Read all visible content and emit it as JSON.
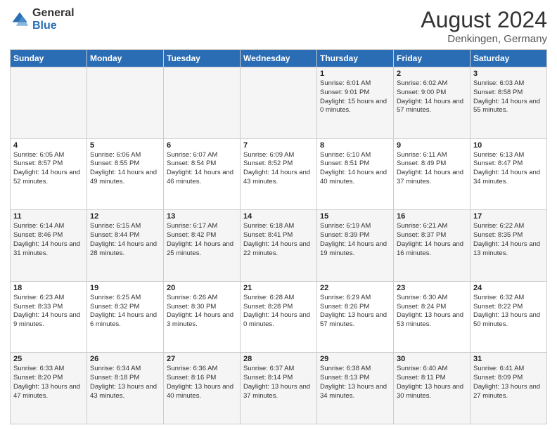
{
  "logo": {
    "general": "General",
    "blue": "Blue"
  },
  "header": {
    "month": "August 2024",
    "location": "Denkingen, Germany"
  },
  "weekdays": [
    "Sunday",
    "Monday",
    "Tuesday",
    "Wednesday",
    "Thursday",
    "Friday",
    "Saturday"
  ],
  "weeks": [
    [
      {
        "day": "",
        "info": ""
      },
      {
        "day": "",
        "info": ""
      },
      {
        "day": "",
        "info": ""
      },
      {
        "day": "",
        "info": ""
      },
      {
        "day": "1",
        "info": "Sunrise: 6:01 AM\nSunset: 9:01 PM\nDaylight: 15 hours and 0 minutes."
      },
      {
        "day": "2",
        "info": "Sunrise: 6:02 AM\nSunset: 9:00 PM\nDaylight: 14 hours and 57 minutes."
      },
      {
        "day": "3",
        "info": "Sunrise: 6:03 AM\nSunset: 8:58 PM\nDaylight: 14 hours and 55 minutes."
      }
    ],
    [
      {
        "day": "4",
        "info": "Sunrise: 6:05 AM\nSunset: 8:57 PM\nDaylight: 14 hours and 52 minutes."
      },
      {
        "day": "5",
        "info": "Sunrise: 6:06 AM\nSunset: 8:55 PM\nDaylight: 14 hours and 49 minutes."
      },
      {
        "day": "6",
        "info": "Sunrise: 6:07 AM\nSunset: 8:54 PM\nDaylight: 14 hours and 46 minutes."
      },
      {
        "day": "7",
        "info": "Sunrise: 6:09 AM\nSunset: 8:52 PM\nDaylight: 14 hours and 43 minutes."
      },
      {
        "day": "8",
        "info": "Sunrise: 6:10 AM\nSunset: 8:51 PM\nDaylight: 14 hours and 40 minutes."
      },
      {
        "day": "9",
        "info": "Sunrise: 6:11 AM\nSunset: 8:49 PM\nDaylight: 14 hours and 37 minutes."
      },
      {
        "day": "10",
        "info": "Sunrise: 6:13 AM\nSunset: 8:47 PM\nDaylight: 14 hours and 34 minutes."
      }
    ],
    [
      {
        "day": "11",
        "info": "Sunrise: 6:14 AM\nSunset: 8:46 PM\nDaylight: 14 hours and 31 minutes."
      },
      {
        "day": "12",
        "info": "Sunrise: 6:15 AM\nSunset: 8:44 PM\nDaylight: 14 hours and 28 minutes."
      },
      {
        "day": "13",
        "info": "Sunrise: 6:17 AM\nSunset: 8:42 PM\nDaylight: 14 hours and 25 minutes."
      },
      {
        "day": "14",
        "info": "Sunrise: 6:18 AM\nSunset: 8:41 PM\nDaylight: 14 hours and 22 minutes."
      },
      {
        "day": "15",
        "info": "Sunrise: 6:19 AM\nSunset: 8:39 PM\nDaylight: 14 hours and 19 minutes."
      },
      {
        "day": "16",
        "info": "Sunrise: 6:21 AM\nSunset: 8:37 PM\nDaylight: 14 hours and 16 minutes."
      },
      {
        "day": "17",
        "info": "Sunrise: 6:22 AM\nSunset: 8:35 PM\nDaylight: 14 hours and 13 minutes."
      }
    ],
    [
      {
        "day": "18",
        "info": "Sunrise: 6:23 AM\nSunset: 8:33 PM\nDaylight: 14 hours and 9 minutes."
      },
      {
        "day": "19",
        "info": "Sunrise: 6:25 AM\nSunset: 8:32 PM\nDaylight: 14 hours and 6 minutes."
      },
      {
        "day": "20",
        "info": "Sunrise: 6:26 AM\nSunset: 8:30 PM\nDaylight: 14 hours and 3 minutes."
      },
      {
        "day": "21",
        "info": "Sunrise: 6:28 AM\nSunset: 8:28 PM\nDaylight: 14 hours and 0 minutes."
      },
      {
        "day": "22",
        "info": "Sunrise: 6:29 AM\nSunset: 8:26 PM\nDaylight: 13 hours and 57 minutes."
      },
      {
        "day": "23",
        "info": "Sunrise: 6:30 AM\nSunset: 8:24 PM\nDaylight: 13 hours and 53 minutes."
      },
      {
        "day": "24",
        "info": "Sunrise: 6:32 AM\nSunset: 8:22 PM\nDaylight: 13 hours and 50 minutes."
      }
    ],
    [
      {
        "day": "25",
        "info": "Sunrise: 6:33 AM\nSunset: 8:20 PM\nDaylight: 13 hours and 47 minutes."
      },
      {
        "day": "26",
        "info": "Sunrise: 6:34 AM\nSunset: 8:18 PM\nDaylight: 13 hours and 43 minutes."
      },
      {
        "day": "27",
        "info": "Sunrise: 6:36 AM\nSunset: 8:16 PM\nDaylight: 13 hours and 40 minutes."
      },
      {
        "day": "28",
        "info": "Sunrise: 6:37 AM\nSunset: 8:14 PM\nDaylight: 13 hours and 37 minutes."
      },
      {
        "day": "29",
        "info": "Sunrise: 6:38 AM\nSunset: 8:13 PM\nDaylight: 13 hours and 34 minutes."
      },
      {
        "day": "30",
        "info": "Sunrise: 6:40 AM\nSunset: 8:11 PM\nDaylight: 13 hours and 30 minutes."
      },
      {
        "day": "31",
        "info": "Sunrise: 6:41 AM\nSunset: 8:09 PM\nDaylight: 13 hours and 27 minutes."
      }
    ]
  ]
}
